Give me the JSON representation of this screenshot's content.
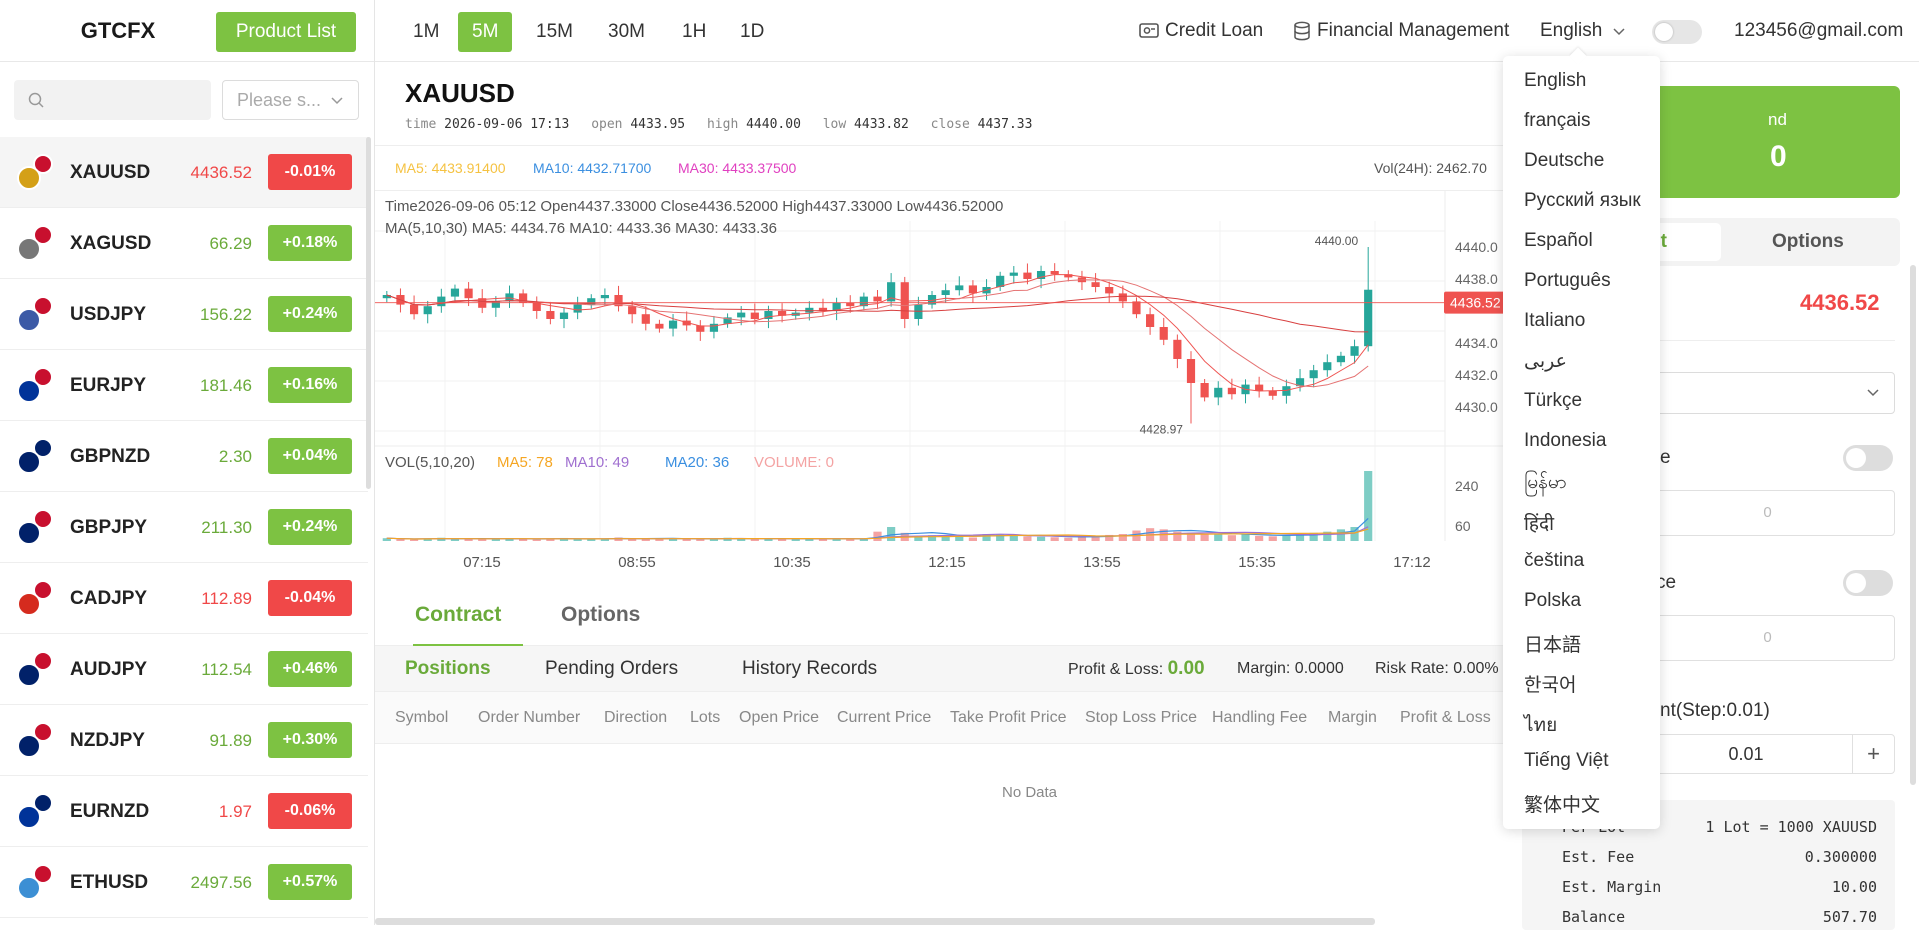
{
  "header": {
    "logo": "GTCFX",
    "product_list_label": "Product List",
    "timeframes": [
      "1M",
      "5M",
      "15M",
      "30M",
      "1H",
      "1D"
    ],
    "active_timeframe": "5M",
    "credit_loan": "Credit Loan",
    "financial_management": "Financial Management",
    "language": "English",
    "user_email": "123456@gmail.com"
  },
  "sidebar": {
    "search_placeholder": "",
    "select_placeholder": "Please s...",
    "symbols": [
      {
        "name": "XAUUSD",
        "price": "4436.52",
        "change": "-0.01%",
        "dir": "down"
      },
      {
        "name": "XAGUSD",
        "price": "66.29",
        "change": "+0.18%",
        "dir": "up"
      },
      {
        "name": "USDJPY",
        "price": "156.22",
        "change": "+0.24%",
        "dir": "up"
      },
      {
        "name": "EURJPY",
        "price": "181.46",
        "change": "+0.16%",
        "dir": "up"
      },
      {
        "name": "GBPNZD",
        "price": "2.30",
        "change": "+0.04%",
        "dir": "up"
      },
      {
        "name": "GBPJPY",
        "price": "211.30",
        "change": "+0.24%",
        "dir": "up"
      },
      {
        "name": "CADJPY",
        "price": "112.89",
        "change": "-0.04%",
        "dir": "down"
      },
      {
        "name": "AUDJPY",
        "price": "112.54",
        "change": "+0.46%",
        "dir": "up"
      },
      {
        "name": "NZDJPY",
        "price": "91.89",
        "change": "+0.30%",
        "dir": "up"
      },
      {
        "name": "EURNZD",
        "price": "1.97",
        "change": "-0.06%",
        "dir": "down"
      },
      {
        "name": "ETHUSD",
        "price": "2497.56",
        "change": "+0.57%",
        "dir": "up"
      }
    ]
  },
  "chart_header": {
    "symbol": "XAUUSD",
    "time_label": "time",
    "time": "2026-09-06 17:13",
    "open_label": "open",
    "open": "4433.95",
    "high_label": "high",
    "high": "4440.00",
    "low_label": "low",
    "low": "4433.82",
    "close_label": "close",
    "close": "4437.33",
    "ma5": "MA5: 4433.91400",
    "ma10": "MA10: 4432.71700",
    "ma30": "MA30: 4433.37500",
    "vol24h": "Vol(24H): 2462.70"
  },
  "chart_data": {
    "type": "candlestick",
    "tooltip": "Time2026-09-06 05:12    Open4437.33000    Close4436.52000    High4437.33000    Low4436.52000",
    "ma_legend": "MA(5,10,30)    MA5: 4434.76    MA10: 4433.36    MA30: 4433.36",
    "vol_legend": {
      "name": "VOL(5,10,20)",
      "ma5": "MA5: 78",
      "ma10": "MA10: 49",
      "ma20": "MA20: 36",
      "volume": "VOLUME: 0"
    },
    "y_ticks": [
      "4440.0",
      "4438.0",
      "4434.0",
      "4432.0",
      "4430.0"
    ],
    "vol_ticks": [
      "240",
      "60"
    ],
    "x_ticks": [
      "07:15",
      "08:55",
      "10:35",
      "12:15",
      "13:55",
      "15:35",
      "17:12"
    ],
    "current_price": "4436.52",
    "max_label": "4440.00",
    "min_label": "4428.97",
    "ylim": [
      4428.5,
      4441
    ],
    "colors": {
      "up": "#26a69a",
      "down": "#ef5350",
      "ma5": "#f5c242",
      "ma10": "#3b8fe0",
      "ma30": "#e040c0"
    },
    "closes": [
      4437.0,
      4436.4,
      4435.8,
      4436.3,
      4436.9,
      4437.4,
      4436.8,
      4436.2,
      4436.6,
      4437.1,
      4436.5,
      4436.0,
      4435.5,
      4435.9,
      4436.4,
      4436.8,
      4437.0,
      4436.3,
      4435.8,
      4435.2,
      4434.9,
      4435.4,
      4435.1,
      4434.7,
      4435.2,
      4435.6,
      4435.9,
      4435.5,
      4436.0,
      4435.7,
      4435.9,
      4436.2,
      4436.0,
      4436.5,
      4436.3,
      4436.9,
      4436.6,
      4437.8,
      4435.5,
      4436.4,
      4437.0,
      4437.3,
      4437.6,
      4437.1,
      4437.5,
      4438.2,
      4438.4,
      4438.0,
      4438.5,
      4438.3,
      4438.1,
      4437.8,
      4437.5,
      4437.1,
      4436.6,
      4435.8,
      4435.0,
      4434.2,
      4433.0,
      4431.5,
      4430.6,
      4431.2,
      4430.8,
      4431.4,
      4431.0,
      4430.7,
      4431.3,
      4431.8,
      4432.3,
      4432.8,
      4433.2,
      4433.8,
      4437.33
    ],
    "volumes": [
      12,
      8,
      6,
      10,
      14,
      9,
      11,
      7,
      8,
      12,
      10,
      6,
      9,
      13,
      8,
      7,
      10,
      15,
      11,
      9,
      8,
      12,
      10,
      7,
      9,
      14,
      11,
      8,
      10,
      9,
      12,
      8,
      7,
      10,
      9,
      11,
      40,
      60,
      35,
      20,
      25,
      18,
      22,
      15,
      30,
      28,
      24,
      20,
      18,
      16,
      14,
      20,
      22,
      26,
      30,
      45,
      55,
      50,
      40,
      35,
      30,
      28,
      25,
      30,
      22,
      20,
      24,
      28,
      35,
      40,
      50,
      60,
      300
    ]
  },
  "orders": {
    "tabs": [
      "Contract",
      "Options"
    ],
    "sub_tabs": [
      "Positions",
      "Pending Orders",
      "History Records"
    ],
    "pl_label": "Profit & Loss:",
    "pl_value": "0.00",
    "margin": "Margin: 0.0000",
    "risk_rate": "Risk Rate: 0.00%",
    "columns": [
      "Symbol",
      "Order Number",
      "Direction",
      "Lots",
      "Open Price",
      "Current Price",
      "Take Profit Price",
      "Stop Loss Price",
      "Handling Fee",
      "Margin",
      "Profit & Loss"
    ],
    "no_data": "No Data"
  },
  "right_panel": {
    "banner_label": "nd",
    "banner_value": "0",
    "tab_contract": "ct",
    "tab_options": "Options",
    "price": "4436.52",
    "toggle1_label": "e",
    "input1_value": "0",
    "toggle2_label": "ce",
    "input2_value": "0",
    "lots_label": "nt(Step:0.01)",
    "lots_value": "0.01",
    "plus": "+",
    "info": [
      {
        "k": "Per Lot",
        "v": "1 Lot = 1000 XAUUSD"
      },
      {
        "k": "Est. Fee",
        "v": "0.300000"
      },
      {
        "k": "Est. Margin",
        "v": "10.00"
      },
      {
        "k": "Balance",
        "v": "507.70"
      }
    ]
  },
  "language_menu": [
    "English",
    "français",
    "Deutsche",
    "Русский язык",
    "Español",
    "Português",
    "Italiano",
    "عربى",
    "Türkçe",
    "Indonesia",
    "မြန်မာ",
    "हिंदी",
    "čeština",
    "Polska",
    "日本語",
    "한국어",
    "ไทย",
    "Tiếng Việt",
    "繁体中文"
  ]
}
